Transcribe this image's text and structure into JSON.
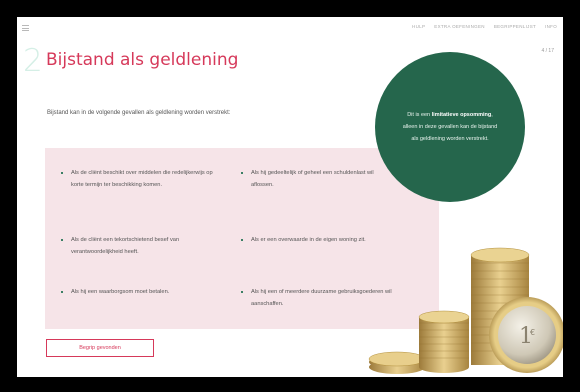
{
  "nav": {
    "items": [
      "Hulp",
      "Extra oefeningen",
      "Begrippenlijst",
      "Info"
    ]
  },
  "page": {
    "chapter_number": "2",
    "title": "Bijstand als geldlening",
    "page_number": "4 / 17"
  },
  "intro": "Bijstand kan in de volgende gevallen als geldlening worden verstrekt:",
  "bullets": [
    "Als de cliënt beschikt over middelen die redelijkerwijs op korte termijn ter beschikking komen.",
    "Als hij gedeeltelijk of geheel een schuldenlast wil aflossen.",
    "Als de cliënt een tekortschietend besef van verantwoordelijkheid heeft.",
    "Als er een overwaarde in de eigen woning zit.",
    "Als hij een waarborgsom moet betalen.",
    "Als hij een of meerdere duurzame gebruiksgoederen wil aanschaffen."
  ],
  "note": {
    "prefix": "Dit is een ",
    "highlight": "limitatieve opsomming",
    "suffix": ", alleen in deze gevallen kan de bijstand als geldlening worden verstrekt."
  },
  "cta_label": "Begrip gevonden",
  "icons": {
    "menu": "hamburger-icon",
    "bullet": "square-bullet-icon",
    "coins": "euro-coins-image"
  },
  "colors": {
    "accent": "#d6395a",
    "green": "#25664c",
    "panel": "#f6e4e8"
  }
}
